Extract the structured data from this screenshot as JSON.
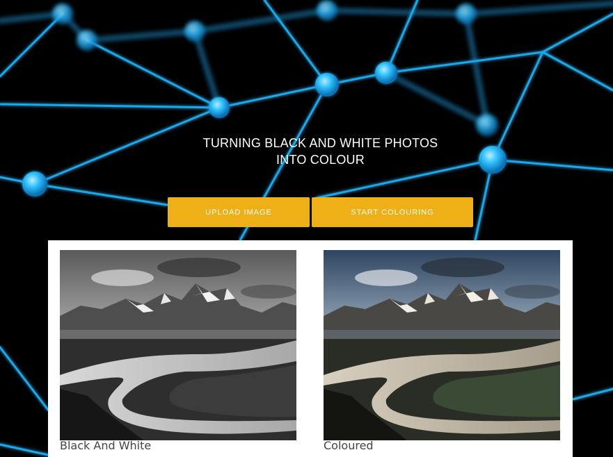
{
  "hero": {
    "title_line1": "TURNING BLACK AND WHITE PHOTOS",
    "title_line2": "INTO COLOUR"
  },
  "actions": {
    "upload_label": "UPLOAD IMAGE",
    "start_label": "START COLOURING"
  },
  "comparison": {
    "bw_caption": "Black And White",
    "color_caption": "Coloured"
  },
  "colors": {
    "background": "#000000",
    "network_line": "#1aa8e8",
    "network_node": "#29b6f6",
    "button": "#efb017",
    "panel": "#ffffff"
  },
  "icons": {
    "background": "network-graph-image"
  }
}
